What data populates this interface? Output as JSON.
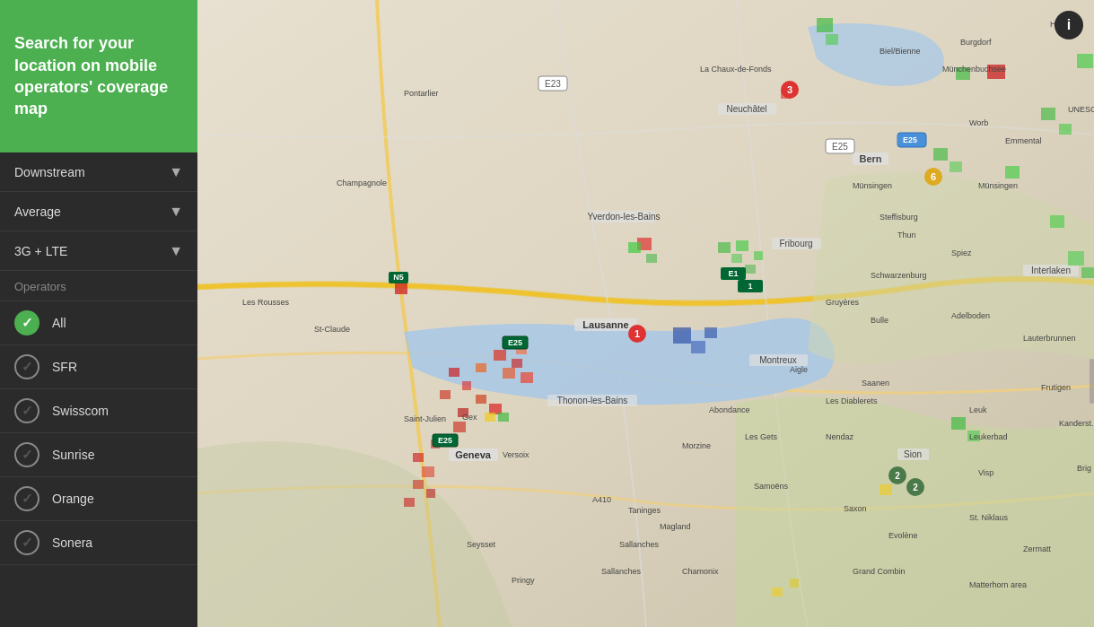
{
  "header": {
    "title": "Search for your location on mobile operators' coverage map"
  },
  "filters": [
    {
      "id": "downstream",
      "label": "Downstream"
    },
    {
      "id": "average",
      "label": "Average"
    },
    {
      "id": "network",
      "label": "3G + LTE"
    }
  ],
  "operators_label": "Operators",
  "operators": [
    {
      "id": "all",
      "label": "All",
      "active": true
    },
    {
      "id": "sfr",
      "label": "SFR",
      "active": false
    },
    {
      "id": "swisscom",
      "label": "Swisscom",
      "active": false
    },
    {
      "id": "sunrise",
      "label": "Sunrise",
      "active": false
    },
    {
      "id": "orange",
      "label": "Orange",
      "active": false
    },
    {
      "id": "sonera",
      "label": "Sonera",
      "active": false
    }
  ],
  "info_button_label": "i",
  "colors": {
    "sidebar_bg": "#2b2b2b",
    "header_bg": "#4caf50",
    "active_check": "#4caf50"
  }
}
